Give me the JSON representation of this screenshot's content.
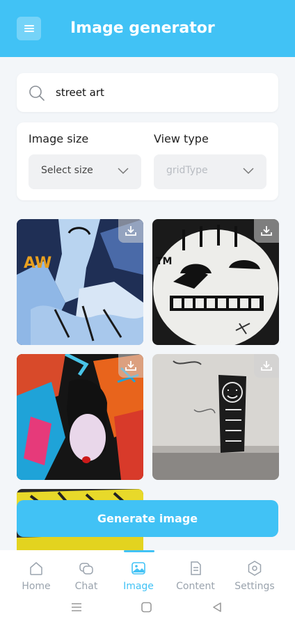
{
  "header": {
    "title": "Image generator",
    "menu_icon": "hamburger-menu-icon"
  },
  "search": {
    "value": "street art",
    "icon": "search-icon"
  },
  "options": {
    "image_size": {
      "label": "Image size",
      "placeholder": "Select size"
    },
    "view_type": {
      "label": "View type",
      "placeholder": "gridType"
    }
  },
  "gallery": {
    "images": [
      {
        "name": "graffiti-blue-figure-image",
        "description_icon": "download-icon"
      },
      {
        "name": "graffiti-smiley-face-image",
        "description_icon": "download-icon"
      },
      {
        "name": "graffiti-colorful-face-image",
        "description_icon": "download-icon"
      },
      {
        "name": "graffiti-stick-figure-image",
        "description_icon": "download-icon"
      },
      {
        "name": "graffiti-yellow-partial-image",
        "description_icon": "download-icon"
      }
    ]
  },
  "generate": {
    "label": "Generate image"
  },
  "bottom_nav": {
    "items": [
      {
        "label": "Home",
        "icon": "home-icon"
      },
      {
        "label": "Chat",
        "icon": "chat-icon"
      },
      {
        "label": "Image",
        "icon": "image-icon",
        "active": true
      },
      {
        "label": "Content",
        "icon": "document-icon"
      },
      {
        "label": "Settings",
        "icon": "settings-icon"
      }
    ]
  },
  "colors": {
    "accent": "#41c2f5",
    "background": "#f3f6f9",
    "muted": "#9aa3ad"
  }
}
